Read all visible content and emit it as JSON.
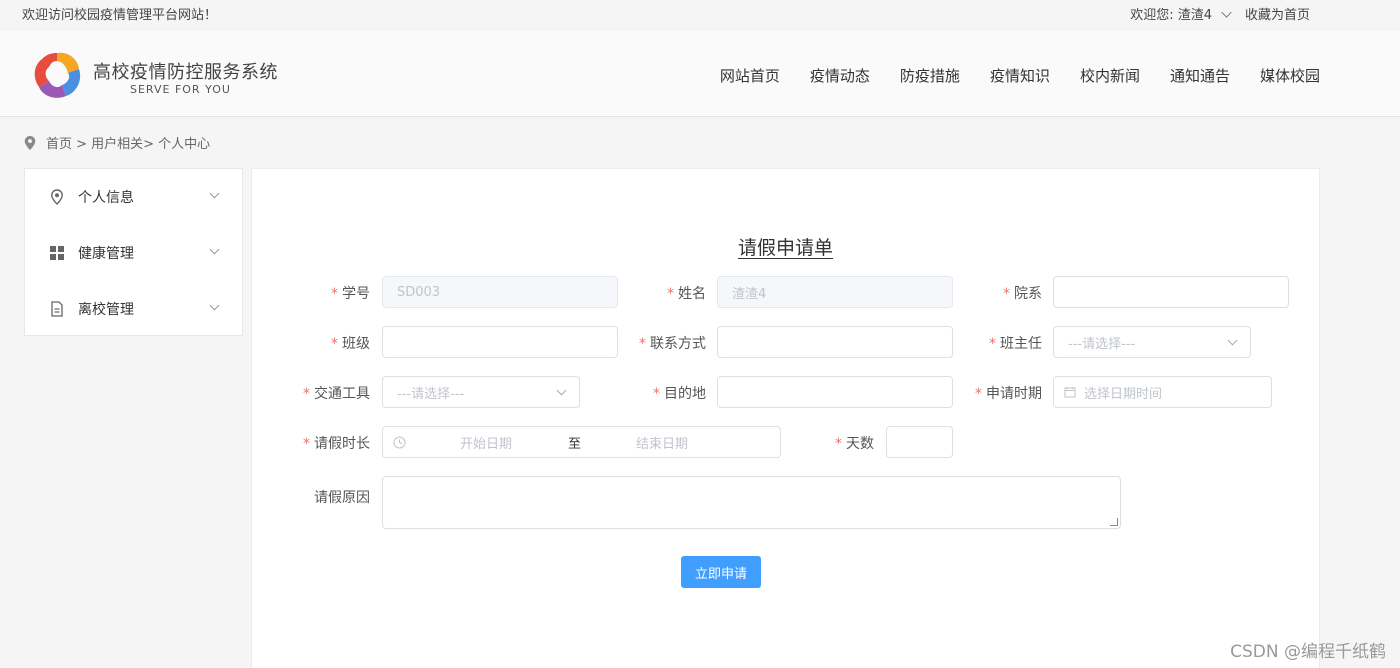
{
  "topbar": {
    "welcome": "欢迎访问校园疫情管理平台网站！",
    "user_greeting": "欢迎您: 渣渣4",
    "favorite": "收藏为首页"
  },
  "header": {
    "title": "高校疫情防控服务系统",
    "subtitle": "SERVE FOR YOU",
    "nav": [
      "网站首页",
      "疫情动态",
      "防疫措施",
      "疫情知识",
      "校内新闻",
      "通知通告",
      "媒体校园"
    ]
  },
  "breadcrumb": "首页 > 用户相关> 个人中心",
  "sidebar": {
    "items": [
      {
        "label": "个人信息",
        "icon": "location-icon"
      },
      {
        "label": "健康管理",
        "icon": "grid-icon"
      },
      {
        "label": "离校管理",
        "icon": "document-icon"
      }
    ]
  },
  "form": {
    "title": "请假申请单",
    "student_id": {
      "label": "学号",
      "value": "SD003"
    },
    "name": {
      "label": "姓名",
      "value": "渣渣4"
    },
    "department": {
      "label": "院系",
      "value": ""
    },
    "class": {
      "label": "班级",
      "value": ""
    },
    "contact": {
      "label": "联系方式",
      "value": ""
    },
    "head_teacher": {
      "label": "班主任",
      "placeholder": "---请选择---"
    },
    "transport": {
      "label": "交通工具",
      "placeholder": "---请选择---"
    },
    "destination": {
      "label": "目的地",
      "value": ""
    },
    "apply_time": {
      "label": "申请时期",
      "placeholder": "选择日期时间"
    },
    "leave_duration": {
      "label": "请假时长",
      "start_placeholder": "开始日期",
      "separator": "至",
      "end_placeholder": "结束日期"
    },
    "days": {
      "label": "天数",
      "value": ""
    },
    "reason": {
      "label": "请假原因",
      "value": ""
    },
    "submit": "立即申请"
  },
  "watermark": "CSDN @编程千纸鹤",
  "colors": {
    "primary": "#409eff",
    "required": "#f56c6c"
  }
}
